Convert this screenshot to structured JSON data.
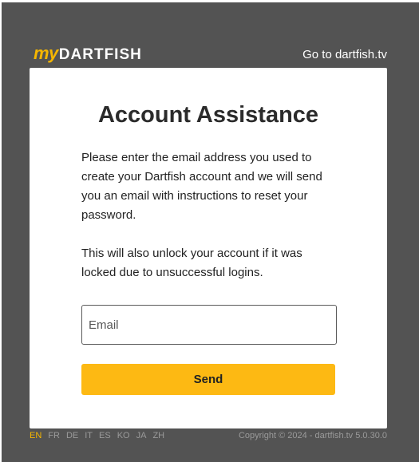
{
  "header": {
    "logo_my": "my",
    "logo_word": "DARTFISH",
    "link_label": "Go to dartfish.tv"
  },
  "card": {
    "title": "Account Assistance",
    "paragraph_1": "Please enter the email address you used to create your Dartfish account and we will send you an email with instructions to reset your password.",
    "paragraph_2": "This will also unlock your account if it was locked due to unsuccessful logins.",
    "email_placeholder": "Email",
    "email_value": "",
    "send_label": "Send"
  },
  "footer": {
    "languages": [
      "EN",
      "FR",
      "DE",
      "IT",
      "ES",
      "KO",
      "JA",
      "ZH"
    ],
    "active_language": "EN",
    "copyright": "Copyright © 2024 - dartfish.tv 5.0.30.0"
  },
  "colors": {
    "accent": "#fdb913",
    "background": "#535353",
    "card": "#ffffff"
  }
}
